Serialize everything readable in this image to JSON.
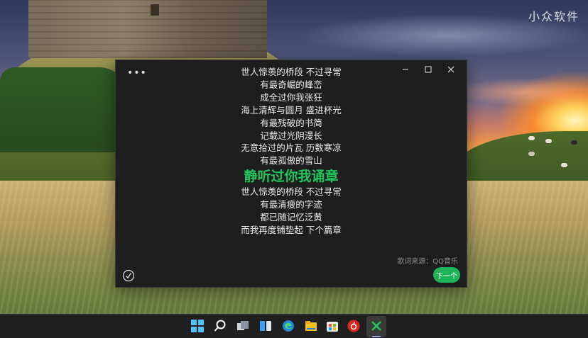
{
  "watermark": "小众软件",
  "window": {
    "menu_icon": "more-dots-icon",
    "menu_label": "•••",
    "controls": [
      "minimize-icon",
      "maximize-icon",
      "close-icon"
    ]
  },
  "lyrics": {
    "lines_before": [
      "世人惊羡的桥段 不过寻常",
      "有最奇崛的峰峦",
      "成全过你我张狂",
      "海上清辉与圆月 盛进杯光",
      "有最残破的书简",
      "记载过光阴漫长",
      "无意拾过的片瓦 历数寒凉",
      "有最孤傲的雪山"
    ],
    "current": "静听过你我诵章",
    "lines_after": [
      "世人惊羡的桥段 不过寻常",
      "有最清瘦的字迹",
      "都已随记忆泛黄",
      "而我再度铺垫起 下个篇章"
    ],
    "source": "歌词来源：QQ音乐",
    "accent_color": "#22c55e"
  },
  "buttons": {
    "next_label": "下一个",
    "check_icon": "check-circle-icon"
  },
  "taskbar": {
    "icons": [
      "windows-start-icon",
      "search-icon",
      "task-view-icon",
      "widgets-icon",
      "edge-browser-icon",
      "file-explorer-icon",
      "microsoft-store-icon",
      "netease-music-icon",
      "lyrics-app-icon"
    ]
  }
}
